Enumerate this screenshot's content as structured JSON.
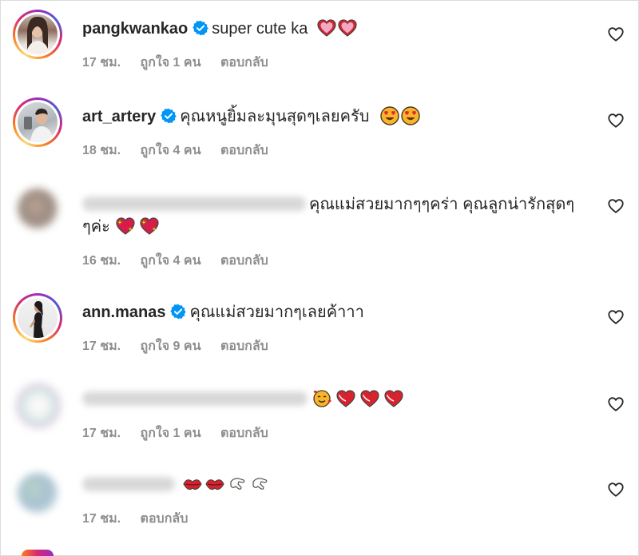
{
  "comments": [
    {
      "username": "pangkwankao",
      "verified": true,
      "text": "super cute ka",
      "emoji": [
        "heart",
        "heart"
      ],
      "time": "17 ชม.",
      "likes": "ถูกใจ 1 คน",
      "reply": "ตอบกลับ"
    },
    {
      "username": "art_artery",
      "verified": true,
      "text": "คุณหนูยิ้มละมุนสุดๆเลยครับ",
      "emoji": [
        "heart-eyes",
        "heart-eyes"
      ],
      "time": "18 ชม.",
      "likes": "ถูกใจ 4 คน",
      "reply": "ตอบกลับ"
    },
    {
      "username": "",
      "verified": false,
      "text": "คุณแม่สวยมากๆๆคร่า คุณลูกน่ารักสุดๆ ๆค่ะ",
      "emoji": [
        "sparkling-heart",
        "sparkling-heart"
      ],
      "time": "16 ชม.",
      "likes": "ถูกใจ 4 คน",
      "reply": "ตอบกลับ"
    },
    {
      "username": "ann.manas",
      "verified": true,
      "text": "คุณแม่สวยมากๆเลยค้าาา",
      "emoji": [],
      "time": "17 ชม.",
      "likes": "ถูกใจ 9 คน",
      "reply": "ตอบกลับ"
    },
    {
      "username": "",
      "verified": false,
      "text": "",
      "emoji": [
        "smiling-face-with-hearts",
        "heart-exclamation",
        "heart-exclamation",
        "heart-exclamation"
      ],
      "time": "17 ชม.",
      "likes": "ถูกใจ 1 คน",
      "reply": "ตอบกลับ"
    },
    {
      "username": "",
      "verified": false,
      "text": "",
      "emoji": [
        "lips",
        "lips",
        "pinching-hand",
        "pinching-hand"
      ],
      "time": "17 ชม.",
      "likes": "",
      "reply": "ตอบกลับ"
    }
  ],
  "colors": {
    "text": "#262626",
    "meta": "#8e8e8e",
    "verified": "#0095f6",
    "heart": "#e0245e"
  },
  "icons": {
    "verified": "verified-badge-icon",
    "like": "heart-outline-icon"
  }
}
